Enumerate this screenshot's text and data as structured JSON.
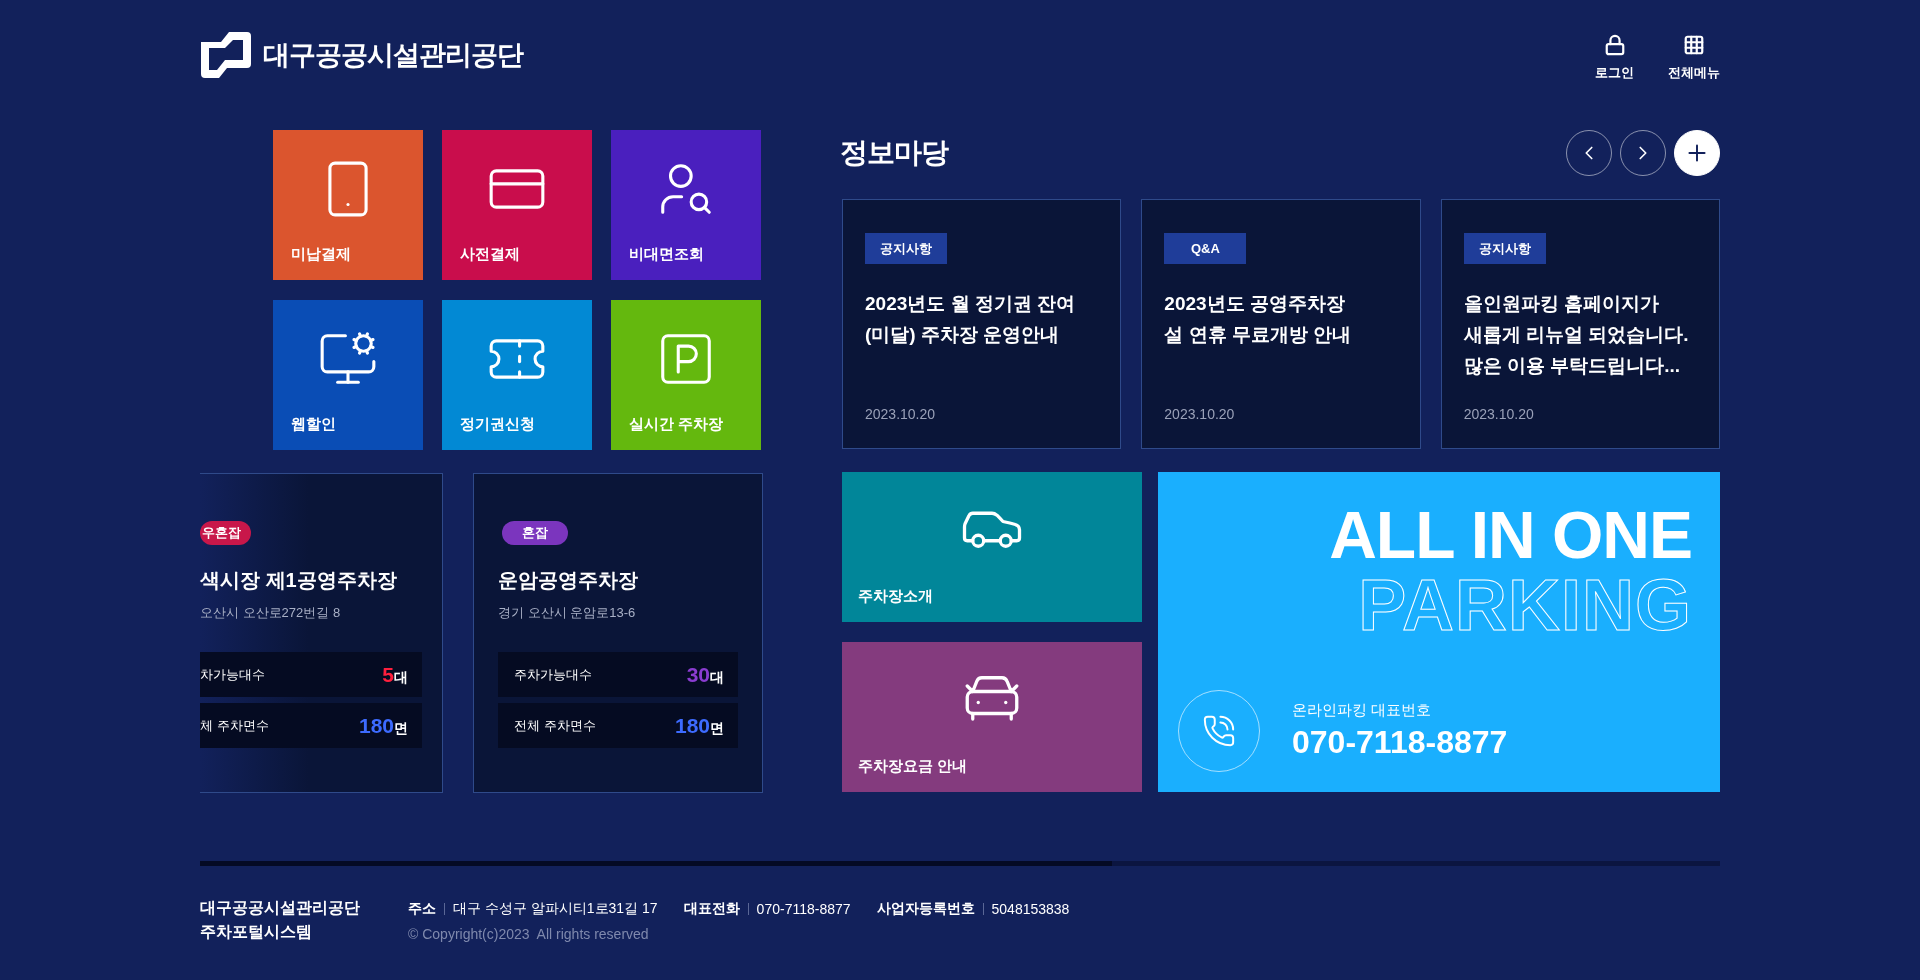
{
  "header": {
    "logo_text": "대구공공시설관리공단",
    "actions": [
      {
        "label": "로그인"
      },
      {
        "label": "전체메뉴"
      }
    ]
  },
  "quick_menu": [
    {
      "label": "미납결제",
      "color": "#db552e"
    },
    {
      "label": "사전결제",
      "color": "#c90d4c"
    },
    {
      "label": "비대면조회",
      "color": "#4a1fbe"
    },
    {
      "label": "웹할인",
      "color": "#0a4db5"
    },
    {
      "label": "정기권신청",
      "color": "#0289d4"
    },
    {
      "label": "실시간 주차장",
      "color": "#64b80e"
    }
  ],
  "parking_lots": [
    {
      "cut_off": true,
      "status": "우혼잡",
      "color": "#c8174a",
      "name": "색시장 제1공영주차장",
      "address": "오산시 오산로272번길 8",
      "stats": [
        {
          "label": "차가능대수",
          "value": "5",
          "unit": "대",
          "color": "#ff1f3d"
        },
        {
          "label": "체 주차면수",
          "value": "180",
          "unit": "면",
          "color": "#3d6bff"
        }
      ]
    },
    {
      "cut_off": false,
      "status": "혼잡",
      "color": "#7b35be",
      "name": "운암공영주차장",
      "address": "경기 오산시 운암로13-6",
      "stats": [
        {
          "label": "주차가능대수",
          "value": "30",
          "unit": "대",
          "color": "#8a3cd0"
        },
        {
          "label": "전체 주차면수",
          "value": "180",
          "unit": "면",
          "color": "#3d6bff"
        }
      ]
    }
  ],
  "info": {
    "title": "정보마당",
    "posts": [
      {
        "category": "공지사항",
        "title": "2023년도 월 정기권 잔여\n(미달) 주차장 운영안내",
        "date": "2023.10.20"
      },
      {
        "category": "Q&A",
        "title": "2023년도 공영주차장\n설 연휴 무료개방 안내",
        "date": "2023.10.20"
      },
      {
        "category": "공지사항",
        "title": "올인원파킹 홈페이지가\n새롭게 리뉴얼 되었습니다.\n많은 이용 부탁드립니다...",
        "date": "2023.10.20"
      }
    ]
  },
  "services": [
    {
      "label": "주차장소개",
      "color": "#018699"
    },
    {
      "label": "주차장요금 안내",
      "color": "#843b7e"
    }
  ],
  "banner": {
    "headline": "ALL IN ONE",
    "headline_outline": "PARKING",
    "phone_label": "온라인파킹 대표번호",
    "phone": "070-7118-8877"
  },
  "carousel_progress": {
    "level": 0.6
  },
  "footer": {
    "org": [
      "대구공공시설관리공단",
      "주차포털시스템"
    ],
    "info": [
      {
        "label": "주소",
        "value": "대구 수성구 알파시티1로31길 17"
      },
      {
        "label": "대표전화",
        "value": "070-7118-8877"
      },
      {
        "label": "사업자등록번호",
        "value": "5048153838"
      }
    ],
    "copyright": "© Copyright(c)2023  All rights reserved"
  }
}
